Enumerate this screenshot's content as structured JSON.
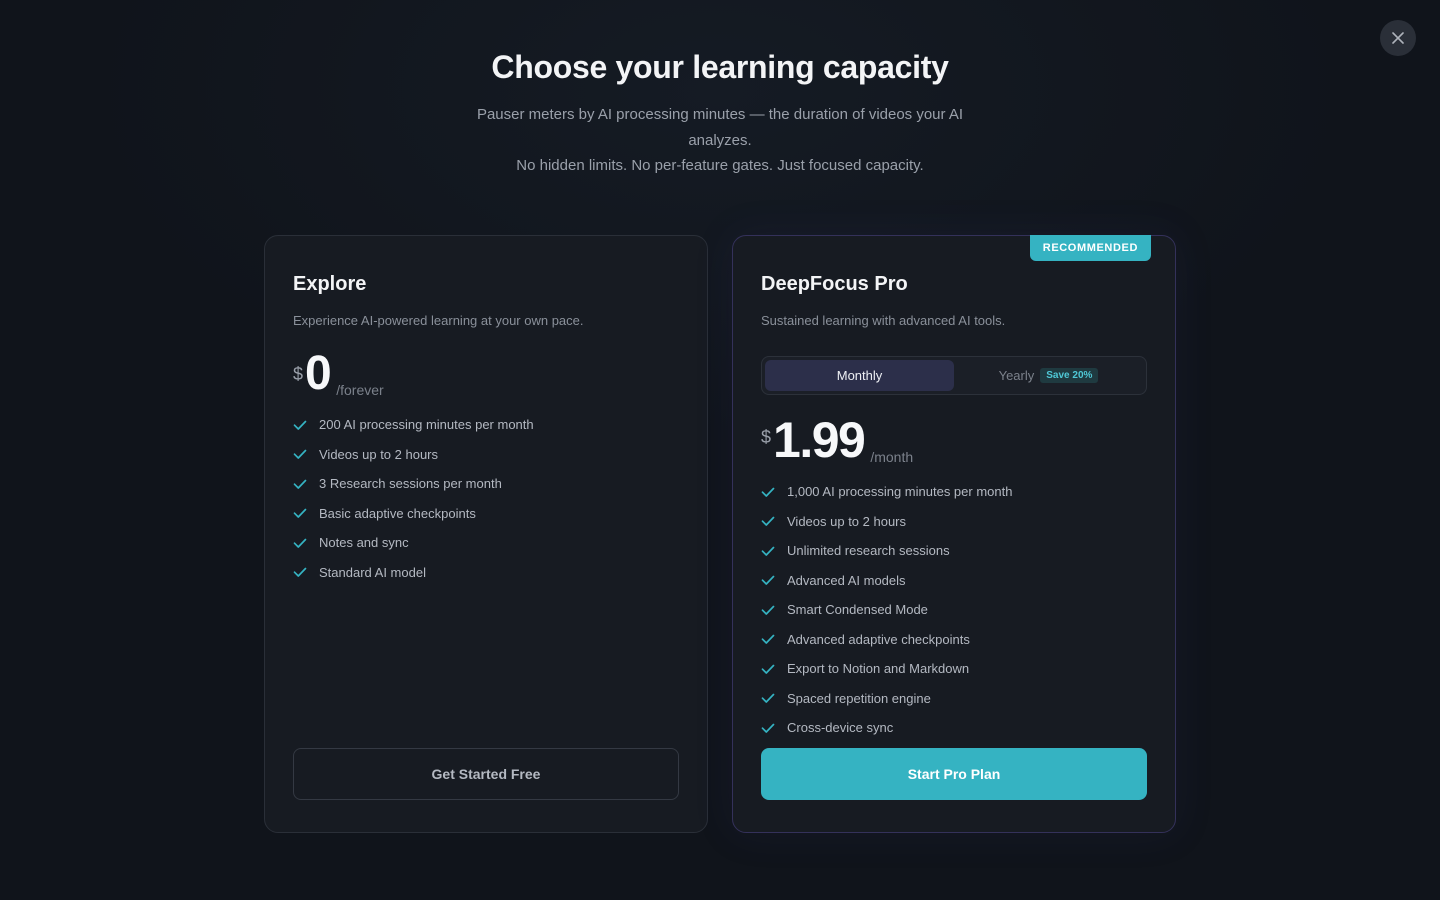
{
  "header": {
    "title": "Choose your learning capacity",
    "subtitle_line1": "Pauser meters by AI processing minutes — the duration of videos your AI analyzes.",
    "subtitle_line2": "No hidden limits. No per-feature gates. Just focused capacity."
  },
  "close": {
    "icon": "close-icon"
  },
  "colors": {
    "accent": "#35b3c2",
    "background": "#10141b",
    "card": "#171b22",
    "toggle_active": "#2c2f4a"
  },
  "plans": [
    {
      "name": "Explore",
      "description": "Experience AI-powered learning at your own pace.",
      "currency": "$",
      "price": "0",
      "period": "/forever",
      "features": [
        "200 AI processing minutes per month",
        "Videos up to 2 hours",
        "3 Research sessions per month",
        "Basic adaptive checkpoints",
        "Notes and sync",
        "Standard AI model"
      ],
      "cta": "Get Started Free"
    },
    {
      "badge": "RECOMMENDED",
      "name": "DeepFocus Pro",
      "description": "Sustained learning with advanced AI tools.",
      "billing_toggle": {
        "monthly": "Monthly",
        "yearly": "Yearly",
        "save": "Save 20%",
        "selected": "Monthly"
      },
      "currency": "$",
      "price": "1.99",
      "period": "/month",
      "features": [
        "1,000 AI processing minutes per month",
        "Videos up to 2 hours",
        "Unlimited research sessions",
        "Advanced AI models",
        "Smart Condensed Mode",
        "Advanced adaptive checkpoints",
        "Export to Notion and Markdown",
        "Spaced repetition engine",
        "Cross-device sync"
      ],
      "cta": "Start Pro Plan"
    }
  ]
}
